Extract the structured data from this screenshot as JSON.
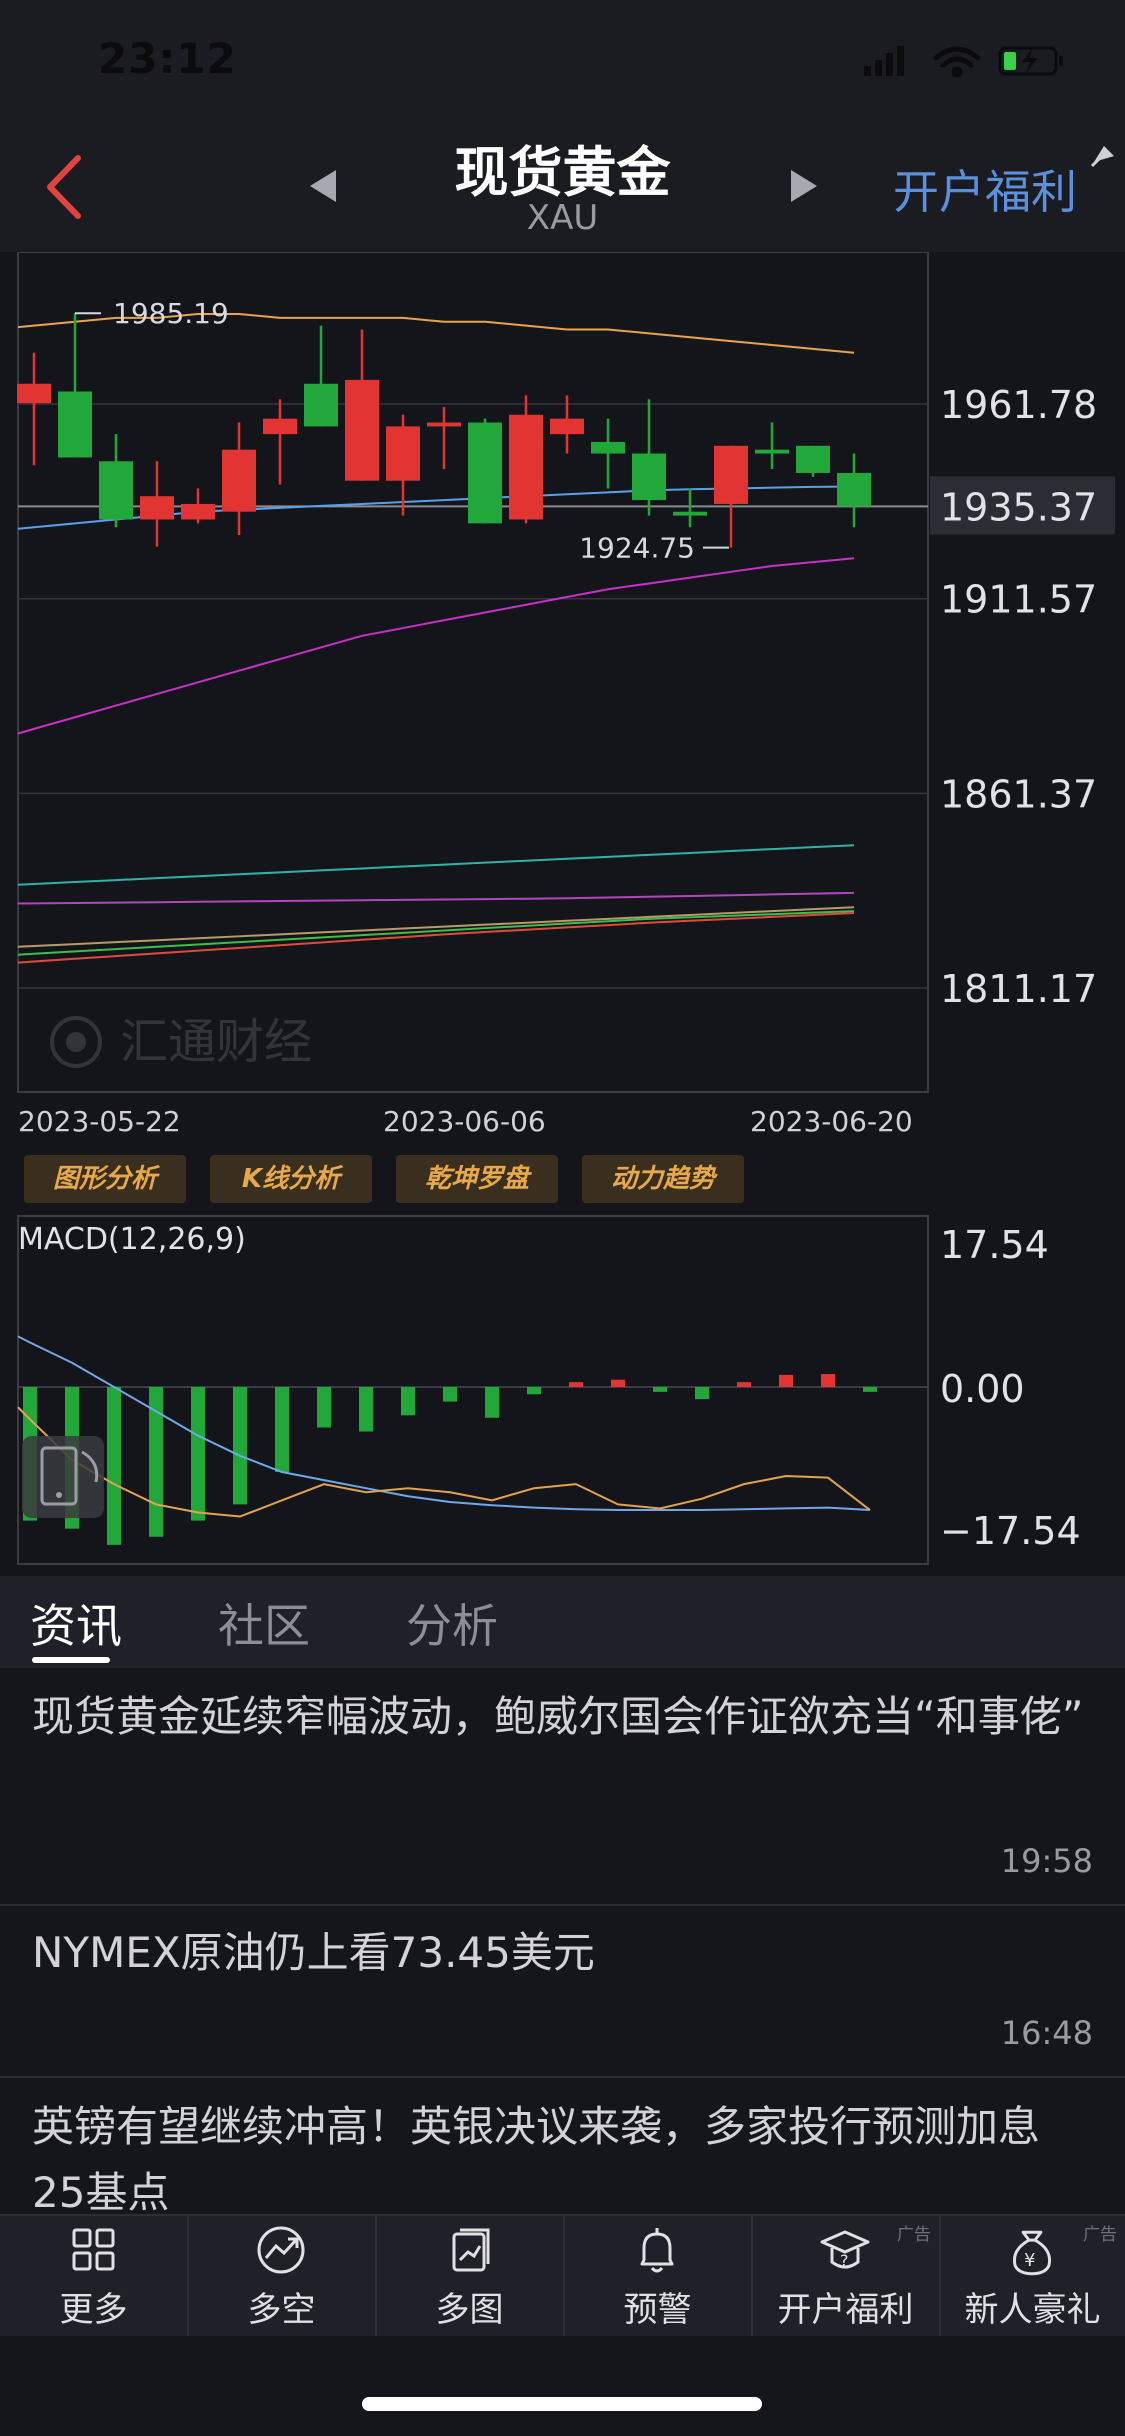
{
  "status_bar": {
    "time": "23:12"
  },
  "header": {
    "title": "现货黄金",
    "subtitle": "XAU",
    "promo_label": "开户福利",
    "back_icon": "chevron-left-icon",
    "prev_icon": "triangle-left-icon",
    "next_icon": "triangle-right-icon"
  },
  "chart_data": [
    {
      "type": "candlestick",
      "y_ticks": [
        "1961.78",
        "1935.37",
        "1911.57",
        "1861.37",
        "1811.17"
      ],
      "current_price": "1935.37",
      "ylim": [
        1811.17,
        1986.5
      ],
      "x_ticks": [
        "2023-05-22",
        "2023-06-06",
        "2023-06-20"
      ],
      "annotations": {
        "high": "1985.19",
        "low": "1924.75"
      },
      "candles": [
        {
          "o": 1962,
          "c": 1967,
          "h": 1975,
          "l": 1946
        },
        {
          "o": 1965,
          "c": 1948,
          "h": 1985.19,
          "l": 1948
        },
        {
          "o": 1947,
          "c": 1932,
          "h": 1954,
          "l": 1930
        },
        {
          "o": 1932,
          "c": 1938,
          "h": 1947,
          "l": 1925
        },
        {
          "o": 1932,
          "c": 1936,
          "h": 1940,
          "l": 1931
        },
        {
          "o": 1934,
          "c": 1950,
          "h": 1957,
          "l": 1928
        },
        {
          "o": 1954,
          "c": 1958,
          "h": 1963,
          "l": 1941
        },
        {
          "o": 1967,
          "c": 1956,
          "h": 1982,
          "l": 1956
        },
        {
          "o": 1942,
          "c": 1968,
          "h": 1981,
          "l": 1942
        },
        {
          "o": 1942,
          "c": 1956,
          "h": 1959,
          "l": 1933
        },
        {
          "o": 1956,
          "c": 1957,
          "h": 1961,
          "l": 1945
        },
        {
          "o": 1957,
          "c": 1931,
          "h": 1958,
          "l": 1931
        },
        {
          "o": 1932,
          "c": 1959,
          "h": 1964,
          "l": 1931
        },
        {
          "o": 1954,
          "c": 1958,
          "h": 1964,
          "l": 1949
        },
        {
          "o": 1952,
          "c": 1949,
          "h": 1958,
          "l": 1940
        },
        {
          "o": 1949,
          "c": 1937,
          "h": 1963,
          "l": 1933
        },
        {
          "o": 1934,
          "c": 1933,
          "h": 1940,
          "l": 1930
        },
        {
          "o": 1936,
          "c": 1951,
          "h": 1951,
          "l": 1924.75
        },
        {
          "o": 1950,
          "c": 1949,
          "h": 1957,
          "l": 1945
        },
        {
          "o": 1951,
          "c": 1944,
          "h": 1951,
          "l": 1943
        },
        {
          "o": 1944,
          "c": 1935.37,
          "h": 1949,
          "l": 1930
        }
      ],
      "moving_averages": [
        {
          "color": "#e9a24d",
          "values": [
            1982,
            1983,
            1984,
            1984,
            1985,
            1985,
            1984,
            1984,
            1984,
            1984,
            1983,
            1983,
            1982,
            1981,
            1981,
            1980,
            1979,
            1978,
            1977,
            1976,
            1975
          ]
        },
        {
          "color": "#5aa0e6",
          "values": [
            1930,
            1931,
            1932,
            1933,
            1934,
            1934.5,
            1935,
            1935.5,
            1936,
            1936.5,
            1937,
            1937.5,
            1938,
            1938.5,
            1939,
            1939.5,
            1939.8,
            1940,
            1940.2,
            1940.4,
            1940.5
          ]
        },
        {
          "color": "#c532c5",
          "values": [
            1878,
            1881,
            1884,
            1887,
            1890,
            1893,
            1896,
            1899,
            1902,
            1904,
            1906,
            1908,
            1910,
            1912,
            1914,
            1915.5,
            1917,
            1918.5,
            1920,
            1921,
            1922
          ]
        },
        {
          "color": "#2fb3a8",
          "values": [
            1838,
            1838.5,
            1839,
            1839.5,
            1840,
            1840.5,
            1841,
            1841.5,
            1842,
            1842.5,
            1843,
            1843.5,
            1844,
            1844.5,
            1845,
            1845.5,
            1846,
            1846.5,
            1847,
            1847.5,
            1848
          ]
        },
        {
          "color": "#b145c0",
          "values": [
            1833,
            1833.1,
            1833.2,
            1833.3,
            1833.4,
            1833.5,
            1833.6,
            1833.7,
            1833.8,
            1833.9,
            1834,
            1834.1,
            1834.2,
            1834.3,
            1834.5,
            1834.7,
            1834.9,
            1835.1,
            1835.3,
            1835.5,
            1835.7
          ]
        },
        {
          "color": "#b89a6a",
          "values": [
            1822,
            1822.5,
            1823,
            1823.5,
            1824,
            1824.5,
            1825,
            1825.5,
            1826,
            1826.5,
            1827,
            1827.5,
            1828,
            1828.5,
            1829,
            1829.5,
            1830,
            1830.5,
            1831,
            1831.5,
            1832
          ]
        },
        {
          "color": "#3cbf4a",
          "values": [
            1820,
            1820.6,
            1821.2,
            1821.8,
            1822.4,
            1823,
            1823.6,
            1824.2,
            1824.8,
            1825.4,
            1826,
            1826.6,
            1827.2,
            1827.8,
            1828.4,
            1829,
            1829.4,
            1829.8,
            1830.2,
            1830.6,
            1831
          ]
        },
        {
          "color": "#e04a3c",
          "values": [
            1818,
            1818.7,
            1819.4,
            1820.1,
            1820.8,
            1821.5,
            1822.2,
            1822.9,
            1823.6,
            1824.3,
            1825,
            1825.6,
            1826.2,
            1826.8,
            1827.4,
            1828,
            1828.5,
            1829,
            1829.5,
            1830,
            1830.5
          ]
        }
      ]
    },
    {
      "type": "bar",
      "title": "MACD(12,26,9)",
      "y_ticks": [
        "17.54",
        "0.00",
        "−17.54"
      ],
      "ylim": [
        -17.54,
        17.54
      ],
      "histogram": [
        -16.5,
        -17.5,
        -19.5,
        -18.5,
        -16.5,
        -14.5,
        -10.5,
        -5,
        -5.5,
        -3.5,
        -1.8,
        -3.8,
        -0.9,
        0.6,
        0.9,
        -0.6,
        -1.5,
        0.6,
        1.5,
        1.6,
        -0.6
      ],
      "dif": [
        5.5,
        3,
        0,
        -3,
        -6,
        -8.5,
        -10.5,
        -11.5,
        -12.5,
        -13.5,
        -14.2,
        -14.6,
        -14.9,
        -15.1,
        -15.2,
        -15.2,
        -15.2,
        -15.1,
        -15,
        -14.9,
        -15.2
      ],
      "dea": [
        -4,
        -9,
        -12,
        -14.5,
        -15.5,
        -16,
        -14,
        -12,
        -13,
        -12.5,
        -13,
        -14,
        -12.5,
        -12,
        -14.5,
        -15,
        -13.8,
        -12,
        -11,
        -11.2,
        -15.2
      ]
    }
  ],
  "watermark": "汇通财经",
  "tools": [
    "图形分析",
    "K线分析",
    "乾坤罗盘",
    "动力趋势"
  ],
  "tabs": [
    "资讯",
    "社区",
    "分析"
  ],
  "news": [
    {
      "title": "现货黄金延续窄幅波动，鲍威尔国会作证欲充当“和事佬”",
      "time": "19:58"
    },
    {
      "title": "NYMEX原油仍上看73.45美元",
      "time": "16:48"
    },
    {
      "title": "英镑有望继续冲高！英银决议来袭，多家投行预测加息25基点",
      "time": ""
    }
  ],
  "bottom_nav": [
    {
      "label": "更多",
      "icon": "grid-icon",
      "ad": ""
    },
    {
      "label": "多空",
      "icon": "trend-circle-icon",
      "ad": ""
    },
    {
      "label": "多图",
      "icon": "multi-chart-icon",
      "ad": ""
    },
    {
      "label": "预警",
      "icon": "bell-icon",
      "ad": ""
    },
    {
      "label": "开户福利",
      "icon": "graduation-cap-icon",
      "ad": "广告"
    },
    {
      "label": "新人豪礼",
      "icon": "money-bag-icon",
      "ad": "广告"
    }
  ]
}
